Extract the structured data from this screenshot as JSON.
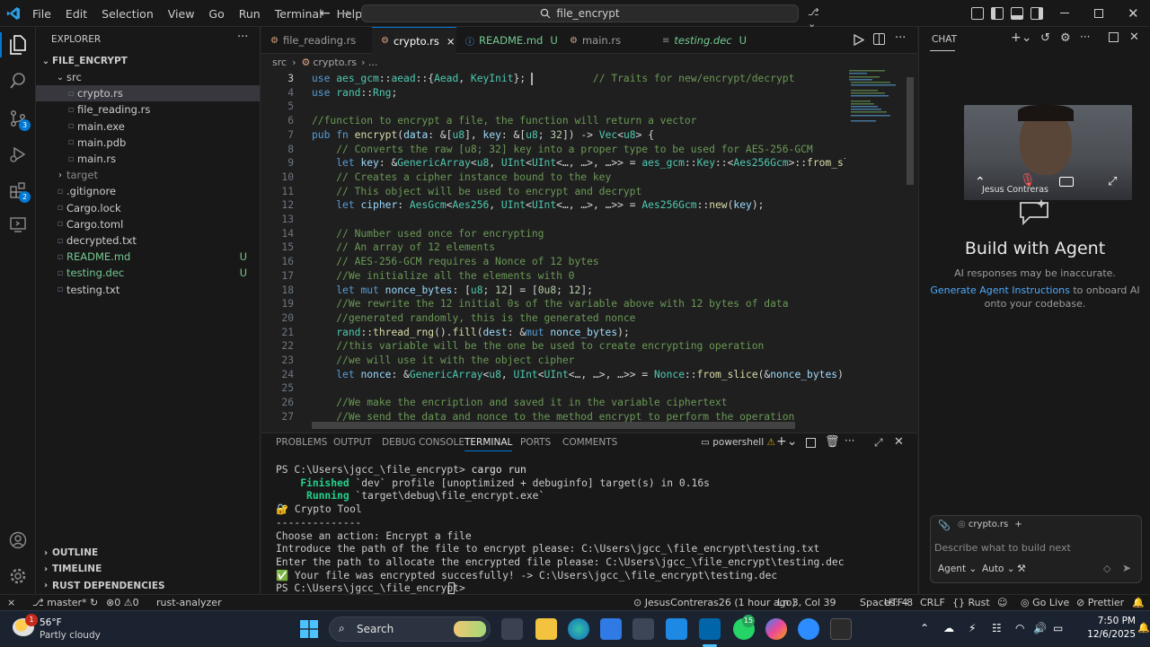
{
  "window": {
    "menu": [
      "File",
      "Edit",
      "Selection",
      "View",
      "Go",
      "Run",
      "Terminal",
      "Help"
    ],
    "search_text": "file_encrypt"
  },
  "explorer": {
    "title": "EXPLORER",
    "project": "FILE_ENCRYPT",
    "items": [
      {
        "label": "src",
        "indent": 1,
        "kind": "folder-open",
        "active": false,
        "badge": "",
        "color": "#cccccc"
      },
      {
        "label": "crypto.rs",
        "indent": 2,
        "kind": "file",
        "active": true,
        "badge": "",
        "color": "#cccccc"
      },
      {
        "label": "file_reading.rs",
        "indent": 2,
        "kind": "file",
        "active": false,
        "badge": "",
        "color": "#cccccc"
      },
      {
        "label": "main.exe",
        "indent": 2,
        "kind": "file",
        "active": false,
        "badge": "",
        "color": "#cccccc"
      },
      {
        "label": "main.pdb",
        "indent": 2,
        "kind": "file",
        "active": false,
        "badge": "",
        "color": "#cccccc"
      },
      {
        "label": "main.rs",
        "indent": 2,
        "kind": "file",
        "active": false,
        "badge": "",
        "color": "#cccccc"
      },
      {
        "label": "target",
        "indent": 1,
        "kind": "folder",
        "active": false,
        "badge": "",
        "color": "#8b8b8b"
      },
      {
        "label": ".gitignore",
        "indent": 1,
        "kind": "file",
        "active": false,
        "badge": "",
        "color": "#cccccc"
      },
      {
        "label": "Cargo.lock",
        "indent": 1,
        "kind": "file",
        "active": false,
        "badge": "",
        "color": "#cccccc"
      },
      {
        "label": "Cargo.toml",
        "indent": 1,
        "kind": "file",
        "active": false,
        "badge": "",
        "color": "#cccccc"
      },
      {
        "label": "decrypted.txt",
        "indent": 1,
        "kind": "file",
        "active": false,
        "badge": "",
        "color": "#cccccc"
      },
      {
        "label": "README.md",
        "indent": 1,
        "kind": "file",
        "active": false,
        "badge": "U",
        "color": "#73c991"
      },
      {
        "label": "testing.dec",
        "indent": 1,
        "kind": "file",
        "active": false,
        "badge": "U",
        "color": "#73c991"
      },
      {
        "label": "testing.txt",
        "indent": 1,
        "kind": "file",
        "active": false,
        "badge": "",
        "color": "#cccccc"
      }
    ],
    "sections": [
      "OUTLINE",
      "TIMELINE",
      "RUST DEPENDENCIES"
    ]
  },
  "tabs": [
    {
      "label": "file_reading.rs",
      "suffix": "",
      "active": false
    },
    {
      "label": "crypto.rs",
      "suffix": "×",
      "active": true
    },
    {
      "label": "README.md",
      "suffix": "U",
      "active": false
    },
    {
      "label": "main.rs",
      "suffix": "",
      "active": false
    },
    {
      "label": "testing.dec",
      "suffix": "U",
      "active": false
    }
  ],
  "breadcrumb": {
    "part1": "src",
    "sep": "›",
    "part2": "crypto.rs",
    "part3": "› ..."
  },
  "code": [
    {
      "n": "3",
      "t": "use aes_gcm::aead::{Aead, KeyInit};           // Traits for new/encrypt/decrypt"
    },
    {
      "n": "4",
      "t": "use rand::Rng;"
    },
    {
      "n": "5",
      "t": ""
    },
    {
      "n": "6",
      "t": "//function to encrypt a file, the function will return a vector"
    },
    {
      "n": "7",
      "t": "pub fn encrypt(data: &[u8], key: &[u8; 32]) -> Vec<u8> {"
    },
    {
      "n": "8",
      "t": "    // Converts the raw [u8; 32] key into a proper type to be used for AES-256-GCM"
    },
    {
      "n": "9",
      "t": "    let key: &GenericArray<u8, UInt<UInt<…, …>, …>> = aes_gcm::Key::<Aes256Gcm>::from_slice("
    },
    {
      "n": "10",
      "t": "    // Creates a cipher instance bound to the key"
    },
    {
      "n": "11",
      "t": "    // This object will be used to encrypt and decrypt"
    },
    {
      "n": "12",
      "t": "    let cipher: AesGcm<Aes256, UInt<UInt<…, …>, …>> = Aes256Gcm::new(key);"
    },
    {
      "n": "13",
      "t": ""
    },
    {
      "n": "14",
      "t": "    // Number used once for encrypting"
    },
    {
      "n": "15",
      "t": "    // An array of 12 elements"
    },
    {
      "n": "16",
      "t": "    // AES-256-GCM requires a Nonce of 12 bytes"
    },
    {
      "n": "17",
      "t": "    //We initialize all the elements with 0"
    },
    {
      "n": "18",
      "t": "    let mut nonce_bytes: [u8; 12] = [0u8; 12];"
    },
    {
      "n": "19",
      "t": "    //We rewrite the 12 initial 0s of the variable above with 12 bytes of data"
    },
    {
      "n": "20",
      "t": "    //generated randomly, this is the generated nonce"
    },
    {
      "n": "21",
      "t": "    rand::thread_rng().fill(dest: &mut nonce_bytes);"
    },
    {
      "n": "22",
      "t": "    //this variable will be the one be used to create encrypting operation"
    },
    {
      "n": "23",
      "t": "    //we will use it with the object cipher"
    },
    {
      "n": "24",
      "t": "    let nonce: &GenericArray<u8, UInt<UInt<…, …>, …>> = Nonce::from_slice(&nonce_bytes);"
    },
    {
      "n": "25",
      "t": ""
    },
    {
      "n": "26",
      "t": "    //We make the encription and saved it in the variable ciphertext"
    },
    {
      "n": "27",
      "t": "    //We send the data and nonce to the method encrypt to perform the operation"
    }
  ],
  "panel": {
    "tabs": [
      "PROBLEMS",
      "OUTPUT",
      "DEBUG CONSOLE",
      "TERMINAL",
      "PORTS",
      "COMMENTS"
    ],
    "active_tab": "TERMINAL",
    "shell": "powershell",
    "lines": [
      "PS C:\\Users\\jgcc_\\file_encrypt> cargo run",
      "    Finished `dev` profile [unoptimized + debuginfo] target(s) in 0.16s",
      "     Running `target\\debug\\file_encrypt.exe`",
      "🔐 Crypto Tool",
      "--------------",
      "Choose an action: Encrypt a file",
      "Introduce the path of the file to encrypt please: C:\\Users\\jgcc_\\file_encrypt\\testing.txt",
      "Enter the path to allocate the encrypted file please: C:\\Users\\jgcc_\\file_encrypt\\testing.dec",
      "✅ Your file was encrypted succesfully! -> C:\\Users\\jgcc_\\file_encrypt\\testing.dec",
      "PS C:\\Users\\jgcc_\\file_encrypt> "
    ]
  },
  "chat": {
    "title": "CHAT",
    "video_name": "Jesus Contreras",
    "heading": "Build with Agent",
    "disclaimer": "AI responses may be inaccurate.",
    "link": "Generate Agent Instructions",
    "link_rest": " to onboard AI",
    "link_rest2": "onto your codebase.",
    "context_file": "crypto.rs",
    "input_placeholder": "Describe what to build next",
    "mode": "Agent",
    "model": "Auto"
  },
  "status": {
    "branch": "master*",
    "errors": "0",
    "warnings": "0",
    "analyzer": "rust-analyzer",
    "blame": "JesusContreras26 (1 hour ago)",
    "position": "Ln 3, Col 39",
    "spaces": "Spaces: 4",
    "encoding": "UTF-8",
    "eol": "CRLF",
    "language": "Rust",
    "golive": "Go Live",
    "prettier": "Prettier"
  },
  "taskbar": {
    "weather_temp": "56°F",
    "weather_desc": "Partly cloudy",
    "search": "Search",
    "time": "7:50 PM",
    "date": "12/6/2025",
    "weather_badge": "1",
    "wa_badge": "15"
  }
}
